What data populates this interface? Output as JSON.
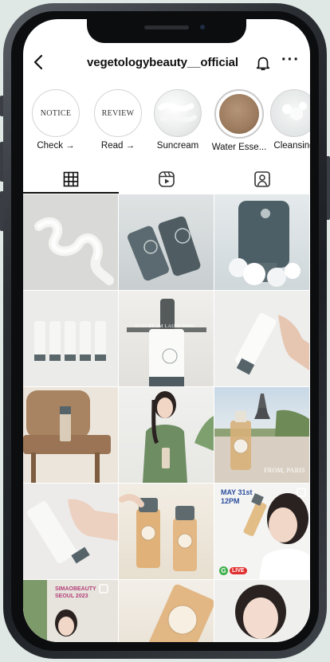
{
  "header": {
    "handle": "vegetologybeauty__official"
  },
  "highlights": [
    {
      "inner": "NOTICE",
      "label": "Check →"
    },
    {
      "inner": "REVIEW",
      "label": "Read →"
    },
    {
      "inner": "",
      "label": "Suncream"
    },
    {
      "inner": "",
      "label": "Water Esse..."
    },
    {
      "inner": "",
      "label": "Cleansing"
    }
  ],
  "tabs": [
    "grid-icon",
    "reels-icon",
    "tagged-icon"
  ],
  "posts": {
    "launch_sign": "SUNCREAM LAUNCHING",
    "paris_caption": "FROM, PARIS",
    "may_date": "MAY 31st",
    "may_time": "12PM",
    "live_badge": "LIVE",
    "seoul_line1": "SIMAOBEAUTY",
    "seoul_line2": "SEOUL 2023"
  },
  "colors": {
    "accent": "#111111",
    "brand_gray": "#5e6a6e"
  }
}
